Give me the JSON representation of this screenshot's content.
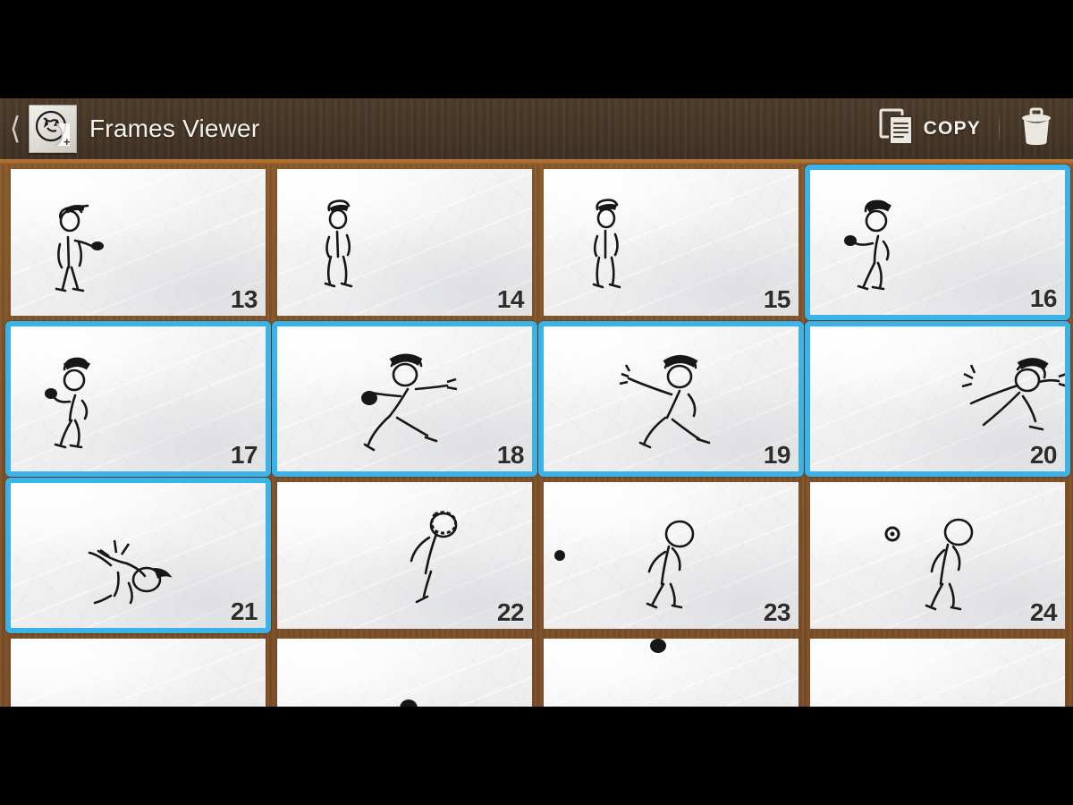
{
  "window": {
    "letterbox_color": "#000000",
    "background_wood_color": "#82542a"
  },
  "header": {
    "back_icon": "back-chevron-icon",
    "app_icon": "app-logo-icon",
    "title": "Frames Viewer",
    "actions": [
      {
        "id": "copy",
        "icon": "copy-icon",
        "label": "COPY"
      },
      {
        "id": "delete",
        "icon": "trash-icon",
        "label": ""
      }
    ],
    "bar_color": "#473727",
    "title_color": "#f4f2ef"
  },
  "selection": {
    "accent_color": "#3bb3e8",
    "selected_frames": [
      16,
      17,
      18,
      19,
      20,
      21
    ],
    "selected_count": 6
  },
  "grid": {
    "columns": 4,
    "frames": [
      {
        "number": "13",
        "selected": false,
        "pose": "stand-hold-ball",
        "partial": false
      },
      {
        "number": "14",
        "selected": false,
        "pose": "stand-crouch",
        "partial": false
      },
      {
        "number": "15",
        "selected": false,
        "pose": "stand-turn",
        "partial": false
      },
      {
        "number": "16",
        "selected": true,
        "pose": "windup-back",
        "partial": false
      },
      {
        "number": "17",
        "selected": true,
        "pose": "windup-lean",
        "partial": false
      },
      {
        "number": "18",
        "selected": true,
        "pose": "throw-stride",
        "partial": false
      },
      {
        "number": "19",
        "selected": true,
        "pose": "throw-release",
        "partial": false
      },
      {
        "number": "20",
        "selected": true,
        "pose": "follow-through-dive",
        "partial": false
      },
      {
        "number": "21",
        "selected": true,
        "pose": "falling-forward",
        "partial": false
      },
      {
        "number": "22",
        "selected": false,
        "pose": "bent-over-hunch",
        "partial": false
      },
      {
        "number": "23",
        "selected": false,
        "pose": "walk-away-ball-left",
        "partial": false
      },
      {
        "number": "24",
        "selected": false,
        "pose": "walk-away-ball-mid",
        "partial": false
      },
      {
        "number": "",
        "selected": false,
        "pose": "ball-bounce-low",
        "partial": true
      },
      {
        "number": "",
        "selected": false,
        "pose": "ball-bounce-high",
        "partial": true
      },
      {
        "number": "",
        "selected": false,
        "pose": "ball-top",
        "partial": true
      },
      {
        "number": "",
        "selected": false,
        "pose": "empty-paper",
        "partial": true
      }
    ]
  }
}
